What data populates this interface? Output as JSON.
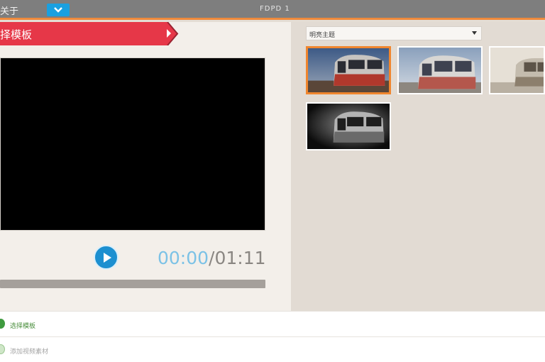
{
  "titlebar": {
    "menu_label": "关于",
    "title": "FDPD 1",
    "accent_color": "#ef8a3c",
    "dropdown_icon": "chevron-down-icon"
  },
  "left_panel": {
    "template_banner_label": "择模板",
    "banner_icon": "arrow-right-icon",
    "play_icon": "play-icon",
    "time": {
      "current": "00:00",
      "separator": "/",
      "total": "01:11"
    }
  },
  "right_panel": {
    "theme_select": {
      "value": "明亮主题",
      "caret_icon": "caret-down-icon"
    },
    "thumbnails": [
      {
        "name": "thumb-warm",
        "selected": true
      },
      {
        "name": "thumb-cool",
        "selected": false
      },
      {
        "name": "thumb-sepia",
        "selected": false
      },
      {
        "name": "thumb-dark",
        "selected": false
      }
    ]
  },
  "options": [
    {
      "label": "选择模板",
      "active": true
    },
    {
      "label": "添加视频素材",
      "active": false
    }
  ]
}
